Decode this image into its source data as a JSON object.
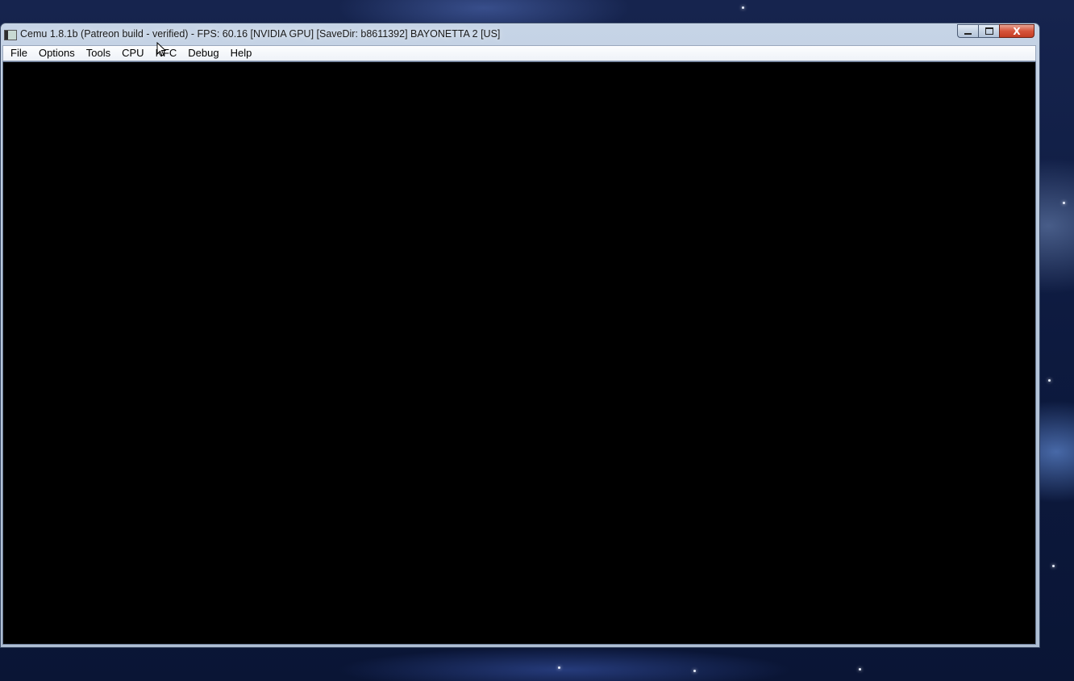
{
  "window": {
    "title": "Cemu 1.8.1b (Patreon build - verified) - FPS: 60.16 [NVIDIA GPU] [SaveDir: b8611392] BAYONETTA 2 [US]",
    "icon": "cemu-app-icon",
    "caption_buttons": {
      "minimize_icon": "minimize-icon",
      "maximize_icon": "maximize-icon",
      "close_label": "X"
    }
  },
  "menubar": {
    "items": [
      {
        "label": "File"
      },
      {
        "label": "Options"
      },
      {
        "label": "Tools"
      },
      {
        "label": "CPU"
      },
      {
        "label": "NFC"
      },
      {
        "label": "Debug"
      },
      {
        "label": "Help"
      }
    ]
  },
  "viewport": {
    "background": "#000000"
  },
  "colors": {
    "close_button": "#c9452b",
    "titlebar": "#c6d4e6",
    "desktop": "#0d1a3f"
  }
}
